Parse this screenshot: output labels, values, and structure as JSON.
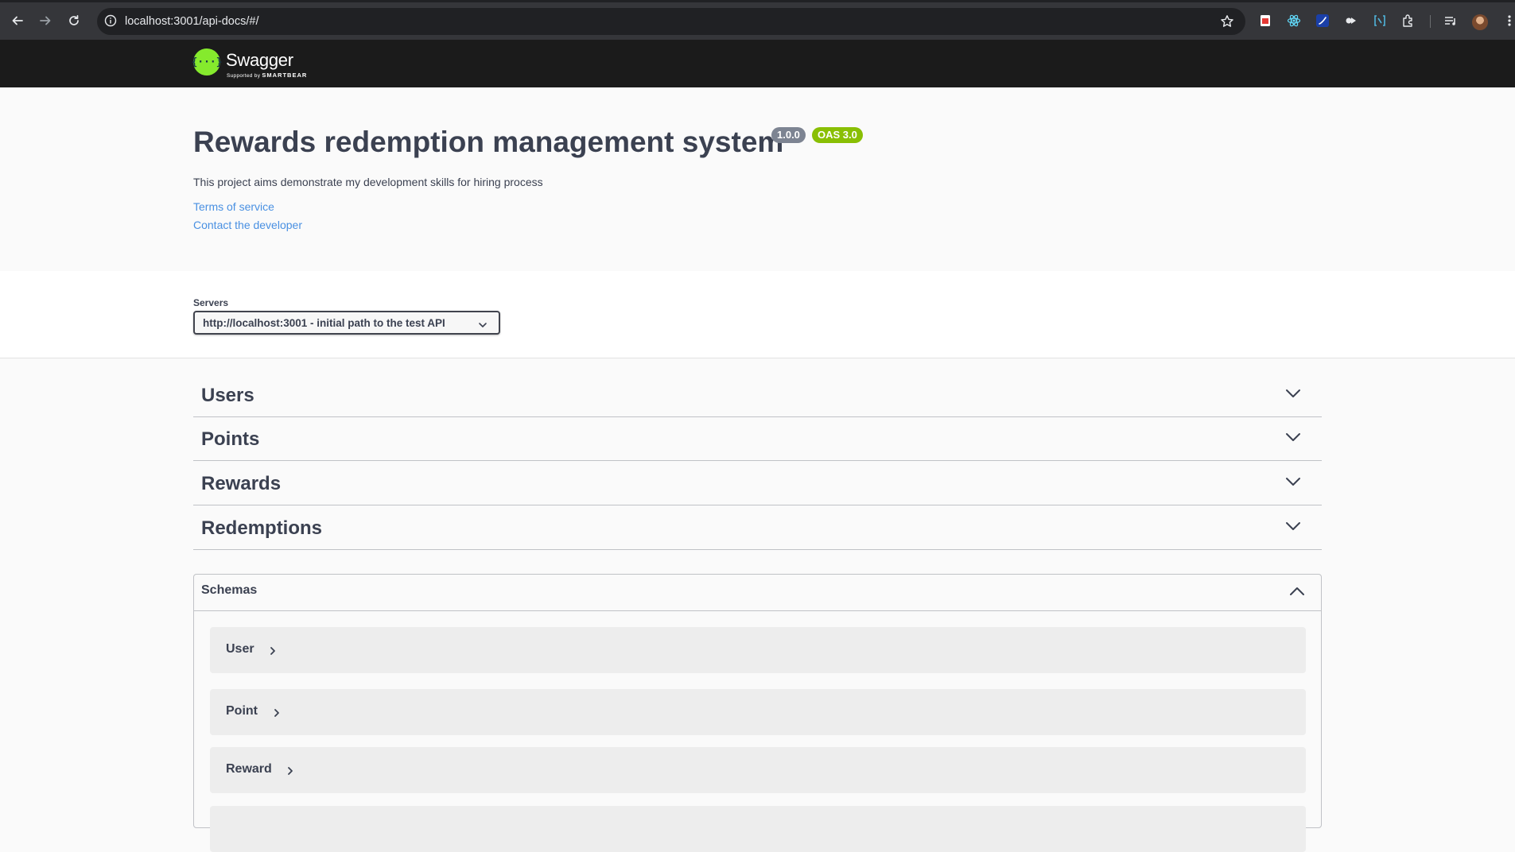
{
  "browser": {
    "url": "localhost:3001/api-docs/#/"
  },
  "topbar": {
    "logo_text": "Swagger",
    "logo_glyph": "{···}",
    "supported_by": "Supported by",
    "brand": "SMARTBEAR"
  },
  "info": {
    "title": "Rewards redemption management system",
    "version": "1.0.0",
    "oas": "OAS 3.0",
    "description": "This project aims demonstrate my development skills for hiring process",
    "terms_link": "Terms of service",
    "contact_link": "Contact the developer"
  },
  "servers": {
    "label": "Servers",
    "selected": "http://localhost:3001 - initial path to the test API"
  },
  "tags": [
    {
      "name": "Users"
    },
    {
      "name": "Points"
    },
    {
      "name": "Rewards"
    },
    {
      "name": "Redemptions"
    }
  ],
  "schemas": {
    "title": "Schemas",
    "models": [
      {
        "name": "User"
      },
      {
        "name": "Point"
      },
      {
        "name": "Reward"
      }
    ]
  },
  "icons": {
    "back": "arrow-left-icon",
    "forward": "arrow-right-icon",
    "reload": "reload-icon",
    "info": "info-icon",
    "star": "bookmark-star-icon",
    "chevron": "chevron-down-icon"
  },
  "colors": {
    "accent_green": "#85ea2d",
    "oas_badge": "#89bf04",
    "version_badge": "#7d8492",
    "link": "#4990e2",
    "text": "#3b4151"
  }
}
